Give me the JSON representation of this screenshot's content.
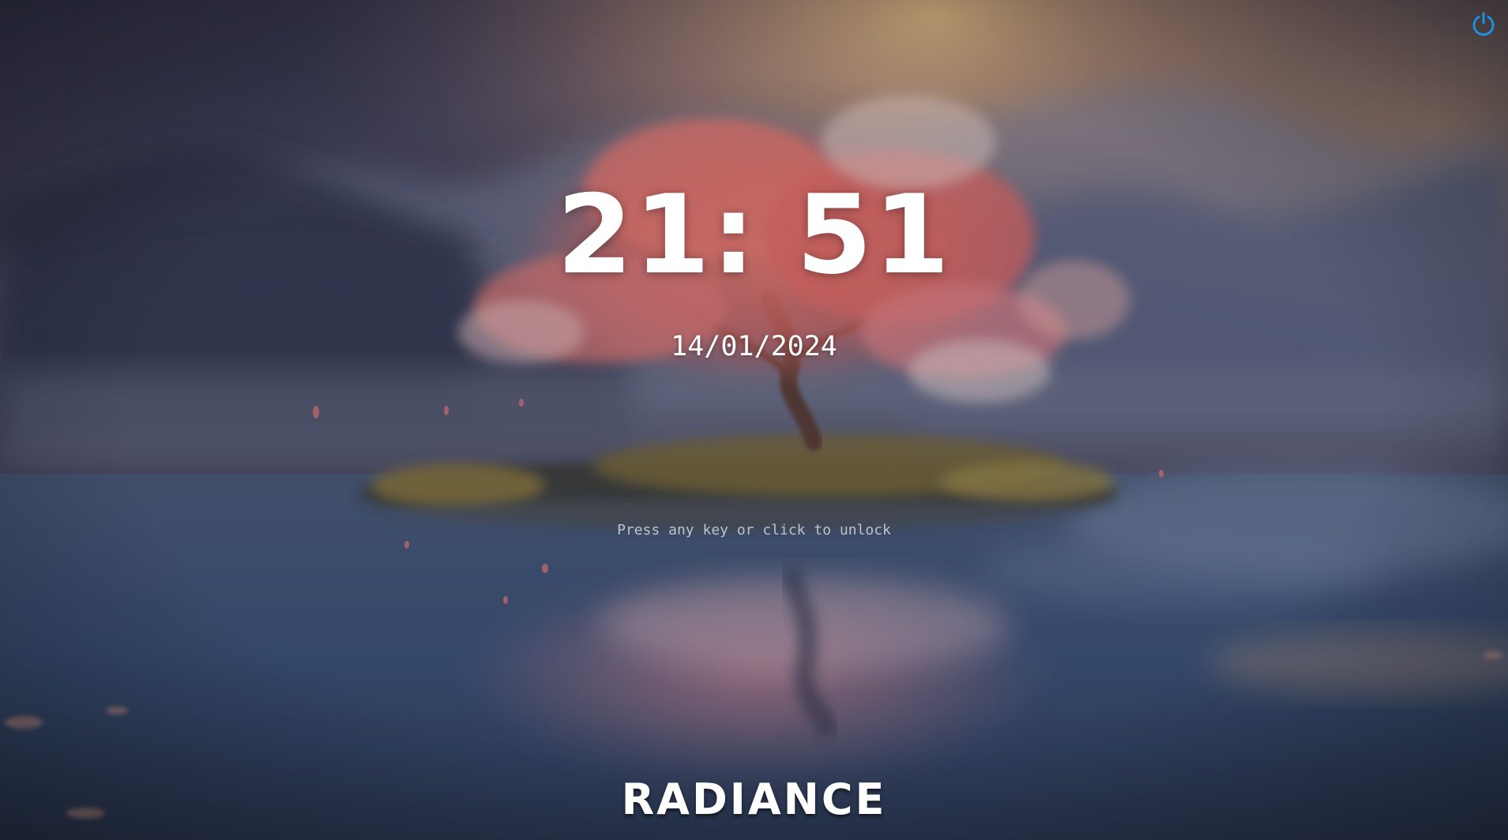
{
  "lock_screen": {
    "time": "21: 51",
    "date": "14/01/2024",
    "unlock_hint": "Press any key or click to unlock",
    "brand": "RADIANCE",
    "power_icon": "power-icon",
    "accent_color": "#1e90e0"
  }
}
